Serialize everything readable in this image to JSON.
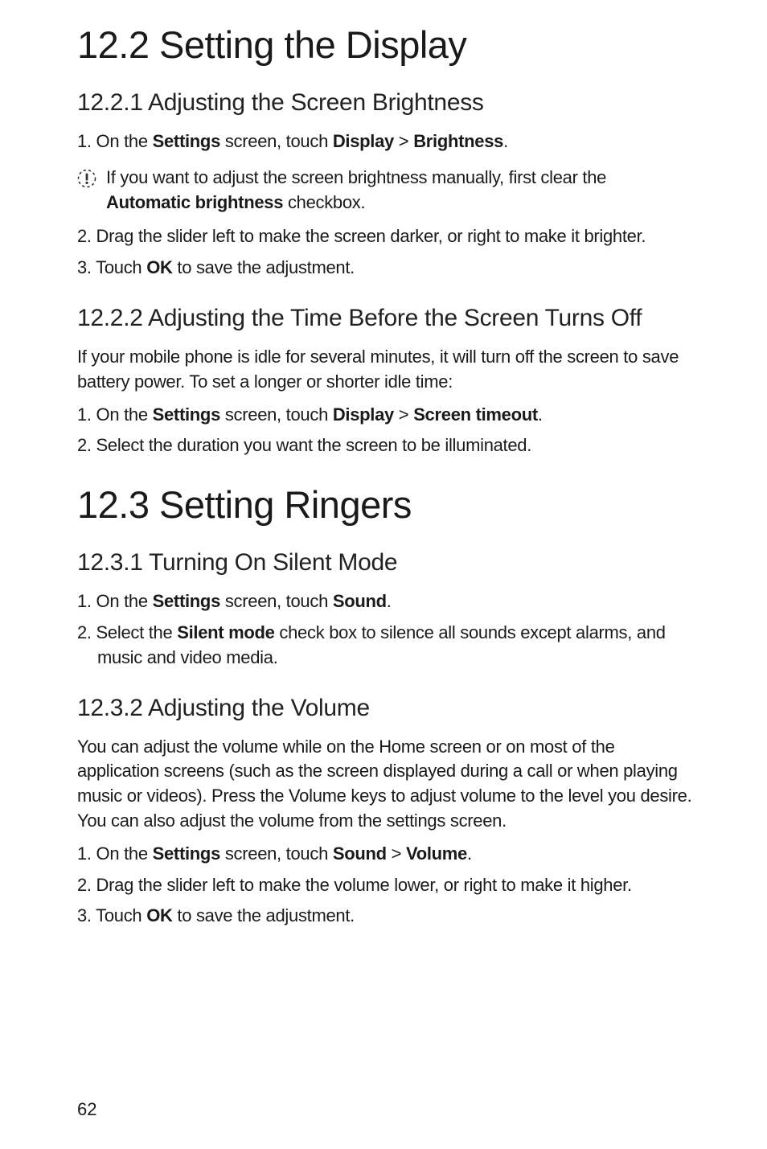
{
  "page_number": "62",
  "s12_2": {
    "title": "12.2  Setting the Display",
    "s12_2_1": {
      "title": "12.2.1  Adjusting the Screen Brightness",
      "step1_pre": "1. On the ",
      "step1_b1": "Settings",
      "step1_mid1": " screen, touch ",
      "step1_b2": "Display",
      "step1_mid2": " > ",
      "step1_b3": "Brightness",
      "step1_post": ".",
      "note_pre": "If you want to adjust the screen brightness manually, first clear the ",
      "note_b1": "Automatic brightness",
      "note_post": " checkbox.",
      "step2": "2. Drag the slider left to make the screen darker, or right to make it brighter.",
      "step3_pre": "3. Touch ",
      "step3_b1": "OK",
      "step3_post": " to save the adjustment."
    },
    "s12_2_2": {
      "title": "12.2.2  Adjusting the Time Before the Screen Turns Off",
      "intro": "If your mobile phone is idle for several minutes, it will turn off the screen to save battery power. To set a longer or shorter idle time:",
      "step1_pre": "1. On the ",
      "step1_b1": "Settings",
      "step1_mid1": " screen, touch ",
      "step1_b2": "Display",
      "step1_mid2": " > ",
      "step1_b3": "Screen timeout",
      "step1_post": ".",
      "step2": "2. Select the duration you want the screen to be illuminated."
    }
  },
  "s12_3": {
    "title": "12.3  Setting Ringers",
    "s12_3_1": {
      "title": "12.3.1  Turning On Silent Mode",
      "step1_pre": "1. On the ",
      "step1_b1": "Settings",
      "step1_mid1": " screen, touch ",
      "step1_b2": "Sound",
      "step1_post": ".",
      "step2_pre": "2. Select the ",
      "step2_b1": "Silent mode",
      "step2_post": " check box to silence all sounds except alarms, and music and video media."
    },
    "s12_3_2": {
      "title": "12.3.2  Adjusting the Volume",
      "intro": "You can adjust the volume while on the Home screen or on most of the application screens (such as the screen displayed during a call or when playing music or videos). Press the Volume keys to adjust volume to the level you desire. You can also adjust the volume from the settings screen.",
      "step1_pre": "1. On the ",
      "step1_b1": "Settings",
      "step1_mid1": " screen, touch ",
      "step1_b2": "Sound",
      "step1_mid2": " > ",
      "step1_b3": "Volume",
      "step1_post": ".",
      "step2": "2. Drag the slider left to make the volume lower, or right to make it higher.",
      "step3_pre": "3. Touch ",
      "step3_b1": "OK",
      "step3_post": " to save the adjustment."
    }
  }
}
